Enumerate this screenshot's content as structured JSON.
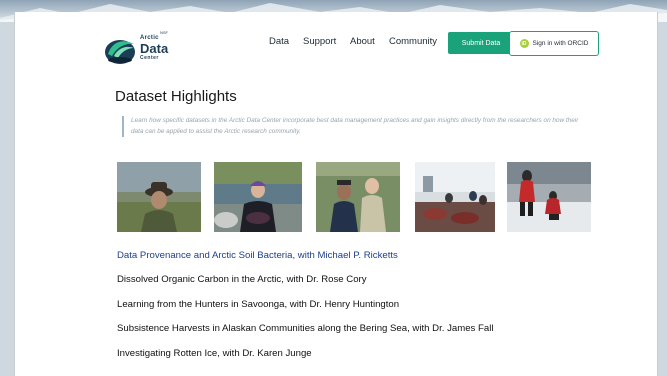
{
  "logo": {
    "small_word": "Arctic",
    "big_word": "Data",
    "tiny_word": "Center",
    "superscript": "NSF"
  },
  "nav": {
    "items": [
      {
        "label": "Data"
      },
      {
        "label": "Support"
      },
      {
        "label": "About"
      },
      {
        "label": "Community"
      }
    ],
    "submit_label": "Submit Data",
    "orcid_label": "Sign in with ORCID",
    "orcid_icon_text": "iD"
  },
  "page": {
    "title": "Dataset Highlights",
    "intro": "Learn how specific datasets in the Arctic Data Center incorporate best data management practices and gain insights directly from the researchers on how their data can be applied to assist the Arctic research community."
  },
  "highlights": [
    {
      "label": "Data Provenance and Arctic Soil Bacteria, with Michael P. Ricketts",
      "active": true
    },
    {
      "label": "Dissolved Organic Carbon in the Arctic, with Dr. Rose Cory",
      "active": false
    },
    {
      "label": "Learning from the Hunters in Savoonga, with Dr. Henry Huntington",
      "active": false
    },
    {
      "label": "Subsistence Harvests in Alaskan Communities along the Bering Sea, with Dr. James Fall",
      "active": false
    },
    {
      "label": "Investigating Rotten Ice, with Dr. Karen Junge",
      "active": false
    }
  ],
  "colors": {
    "accent_green": "#1aa37a",
    "link_blue": "#1f3f8a",
    "logo_navy": "#1c3d56"
  }
}
